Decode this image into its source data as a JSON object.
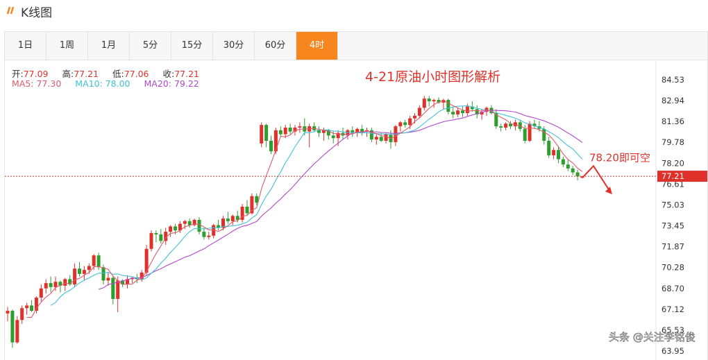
{
  "header": {
    "title": "K线图"
  },
  "tabs": [
    {
      "label": "1日",
      "active": false
    },
    {
      "label": "1周",
      "active": false
    },
    {
      "label": "1月",
      "active": false
    },
    {
      "label": "5分",
      "active": false
    },
    {
      "label": "15分",
      "active": false
    },
    {
      "label": "30分",
      "active": false
    },
    {
      "label": "60分",
      "active": false
    },
    {
      "label": "4时",
      "active": true
    }
  ],
  "ohlc_info": {
    "open_label": "开:",
    "open": "77.09",
    "high_label": "高:",
    "high": "77.21",
    "low_label": "低:",
    "low": "77.06",
    "close_label": "收:",
    "close": "77.21"
  },
  "ma_info": {
    "ma5_label": "MA5:",
    "ma5": "77.30",
    "ma10_label": "MA10:",
    "ma10": "78.00",
    "ma20_label": "MA20:",
    "ma20": "79.22"
  },
  "annotation": {
    "title": "4-21原油小时图形解析",
    "note": "78.20即可空",
    "watermark": "头条 @关注李铭俊"
  },
  "colors": {
    "up": "#e0302a",
    "down": "#2e9e2e",
    "ma5": "#e05a6a",
    "ma10": "#40c0d8",
    "ma20": "#b048c8",
    "accent": "#f7861e",
    "price_line": "#e0302a"
  },
  "chart_data": {
    "type": "candlestick",
    "y_ticks": [
      84.53,
      82.94,
      81.36,
      79.78,
      78.2,
      76.61,
      75.03,
      73.45,
      71.87,
      70.28,
      68.7,
      67.12,
      65.53,
      63.95
    ],
    "ylim": [
      63.95,
      84.53
    ],
    "current_price": 77.21,
    "note_level": 78.2,
    "candles": [
      [
        66.8,
        67.3,
        66.2,
        67.0
      ],
      [
        67.0,
        67.1,
        64.2,
        64.6
      ],
      [
        64.6,
        66.6,
        64.5,
        66.3
      ],
      [
        66.3,
        67.4,
        66.0,
        67.2
      ],
      [
        67.2,
        67.6,
        66.7,
        67.4
      ],
      [
        67.4,
        67.8,
        66.9,
        67.0
      ],
      [
        67.0,
        68.1,
        66.8,
        68.0
      ],
      [
        68.0,
        69.0,
        67.7,
        68.7
      ],
      [
        68.7,
        69.4,
        68.3,
        69.1
      ],
      [
        69.1,
        69.6,
        68.4,
        68.8
      ],
      [
        68.8,
        69.6,
        68.5,
        69.2
      ],
      [
        69.2,
        69.3,
        68.4,
        68.9
      ],
      [
        68.9,
        69.5,
        68.5,
        69.4
      ],
      [
        69.4,
        69.7,
        68.9,
        69.0
      ],
      [
        69.0,
        70.6,
        68.8,
        70.2
      ],
      [
        70.2,
        70.7,
        69.6,
        69.8
      ],
      [
        69.8,
        70.4,
        69.3,
        70.1
      ],
      [
        70.1,
        70.6,
        69.8,
        70.4
      ],
      [
        70.4,
        71.3,
        70.1,
        71.2
      ],
      [
        71.2,
        71.4,
        70.1,
        70.3
      ],
      [
        70.3,
        70.5,
        69.0,
        69.3
      ],
      [
        69.3,
        69.9,
        68.9,
        69.5
      ],
      [
        69.5,
        69.6,
        67.5,
        67.9
      ],
      [
        67.9,
        69.6,
        66.9,
        69.3
      ],
      [
        69.3,
        69.4,
        68.8,
        69.0
      ],
      [
        69.0,
        69.7,
        68.7,
        69.4
      ],
      [
        69.4,
        69.6,
        69.1,
        69.5
      ],
      [
        69.5,
        69.8,
        69.1,
        69.4
      ],
      [
        69.4,
        70.1,
        69.2,
        69.9
      ],
      [
        69.9,
        72.0,
        69.7,
        71.7
      ],
      [
        71.7,
        73.1,
        71.5,
        72.9
      ],
      [
        72.9,
        73.1,
        72.2,
        72.8
      ],
      [
        72.8,
        73.2,
        72.1,
        72.3
      ],
      [
        72.3,
        73.3,
        72.0,
        73.0
      ],
      [
        73.0,
        73.5,
        72.6,
        73.4
      ],
      [
        73.4,
        73.6,
        72.8,
        73.1
      ],
      [
        73.1,
        73.8,
        72.9,
        73.6
      ],
      [
        73.6,
        73.9,
        73.2,
        73.8
      ],
      [
        73.8,
        74.0,
        73.3,
        73.5
      ],
      [
        73.5,
        74.0,
        73.4,
        73.9
      ],
      [
        73.9,
        74.1,
        72.8,
        73.0
      ],
      [
        73.0,
        73.3,
        72.4,
        72.6
      ],
      [
        72.6,
        73.0,
        72.4,
        72.7
      ],
      [
        72.7,
        73.6,
        72.5,
        73.5
      ],
      [
        73.5,
        73.9,
        73.1,
        73.3
      ],
      [
        73.3,
        74.2,
        73.1,
        74.0
      ],
      [
        74.0,
        74.5,
        73.6,
        73.8
      ],
      [
        73.8,
        74.3,
        73.5,
        74.2
      ],
      [
        74.2,
        74.6,
        73.7,
        73.9
      ],
      [
        73.9,
        75.1,
        73.7,
        74.9
      ],
      [
        74.9,
        75.4,
        74.2,
        74.4
      ],
      [
        74.4,
        75.9,
        74.3,
        75.7
      ],
      [
        75.7,
        75.9,
        75.0,
        75.2
      ],
      [
        79.7,
        81.3,
        79.4,
        81.1
      ],
      [
        81.1,
        81.2,
        79.4,
        79.9
      ],
      [
        79.9,
        80.3,
        78.9,
        79.1
      ],
      [
        79.1,
        80.9,
        78.9,
        80.7
      ],
      [
        80.7,
        81.0,
        80.2,
        80.4
      ],
      [
        80.4,
        81.1,
        80.1,
        80.9
      ],
      [
        80.9,
        81.2,
        80.4,
        80.6
      ],
      [
        80.6,
        81.1,
        80.3,
        80.9
      ],
      [
        80.9,
        81.3,
        80.5,
        81.0
      ],
      [
        81.0,
        81.6,
        80.3,
        80.6
      ],
      [
        80.6,
        81.2,
        79.4,
        81.0
      ],
      [
        81.0,
        81.3,
        80.6,
        80.7
      ],
      [
        80.7,
        81.0,
        80.2,
        80.5
      ],
      [
        80.5,
        80.9,
        79.9,
        80.7
      ],
      [
        80.7,
        80.8,
        80.0,
        80.3
      ],
      [
        80.3,
        80.6,
        79.7,
        80.1
      ],
      [
        80.1,
        80.7,
        79.5,
        80.5
      ],
      [
        80.5,
        80.9,
        80.0,
        80.3
      ],
      [
        80.3,
        80.8,
        80.0,
        80.7
      ],
      [
        80.7,
        81.0,
        80.2,
        80.5
      ],
      [
        80.5,
        80.9,
        80.2,
        80.8
      ],
      [
        80.8,
        81.1,
        80.3,
        80.6
      ],
      [
        80.6,
        80.9,
        80.2,
        80.7
      ],
      [
        80.7,
        80.9,
        79.8,
        80.0
      ],
      [
        80.0,
        80.4,
        79.6,
        80.2
      ],
      [
        80.2,
        80.5,
        79.8,
        79.9
      ],
      [
        79.9,
        80.5,
        79.7,
        80.4
      ],
      [
        80.4,
        80.7,
        79.3,
        79.8
      ],
      [
        79.8,
        81.1,
        79.5,
        81.0
      ],
      [
        81.0,
        81.4,
        80.6,
        81.3
      ],
      [
        81.3,
        81.5,
        80.9,
        81.1
      ],
      [
        81.1,
        81.8,
        80.8,
        81.6
      ],
      [
        81.6,
        82.0,
        81.2,
        81.8
      ],
      [
        81.8,
        82.6,
        81.6,
        82.4
      ],
      [
        82.4,
        83.3,
        82.2,
        83.1
      ],
      [
        83.1,
        83.3,
        82.5,
        82.9
      ],
      [
        82.9,
        83.1,
        82.4,
        83.0
      ],
      [
        83.0,
        83.2,
        82.7,
        82.8
      ],
      [
        82.8,
        83.1,
        82.3,
        83.0
      ],
      [
        83.0,
        83.1,
        81.9,
        82.1
      ],
      [
        82.1,
        82.5,
        81.6,
        81.9
      ],
      [
        81.9,
        82.4,
        81.7,
        82.2
      ],
      [
        82.2,
        82.5,
        81.7,
        82.0
      ],
      [
        82.0,
        82.7,
        81.8,
        82.5
      ],
      [
        82.5,
        82.9,
        82.1,
        82.3
      ],
      [
        82.3,
        82.6,
        81.6,
        81.9
      ],
      [
        81.9,
        82.3,
        81.5,
        82.1
      ],
      [
        82.1,
        82.5,
        81.8,
        82.4
      ],
      [
        82.4,
        82.6,
        81.9,
        82.0
      ],
      [
        82.0,
        82.3,
        80.8,
        81.0
      ],
      [
        81.0,
        81.2,
        80.6,
        80.9
      ],
      [
        80.9,
        81.3,
        80.7,
        81.2
      ],
      [
        81.2,
        81.4,
        80.8,
        81.0
      ],
      [
        81.0,
        81.5,
        80.7,
        81.3
      ],
      [
        81.3,
        81.5,
        80.6,
        80.8
      ],
      [
        80.8,
        81.1,
        79.7,
        79.9
      ],
      [
        79.9,
        81.4,
        79.8,
        81.2
      ],
      [
        81.2,
        81.5,
        80.8,
        81.0
      ],
      [
        81.0,
        81.4,
        80.6,
        80.8
      ],
      [
        80.8,
        81.0,
        79.6,
        79.9
      ],
      [
        79.9,
        80.2,
        78.6,
        78.8
      ],
      [
        78.8,
        79.4,
        78.5,
        79.2
      ],
      [
        79.2,
        79.5,
        78.2,
        78.5
      ],
      [
        78.5,
        78.7,
        77.9,
        78.1
      ],
      [
        78.1,
        78.5,
        77.6,
        77.8
      ],
      [
        77.8,
        78.0,
        77.3,
        77.5
      ],
      [
        77.5,
        77.7,
        76.9,
        77.2
      ],
      [
        77.09,
        77.21,
        77.06,
        77.21
      ]
    ]
  }
}
